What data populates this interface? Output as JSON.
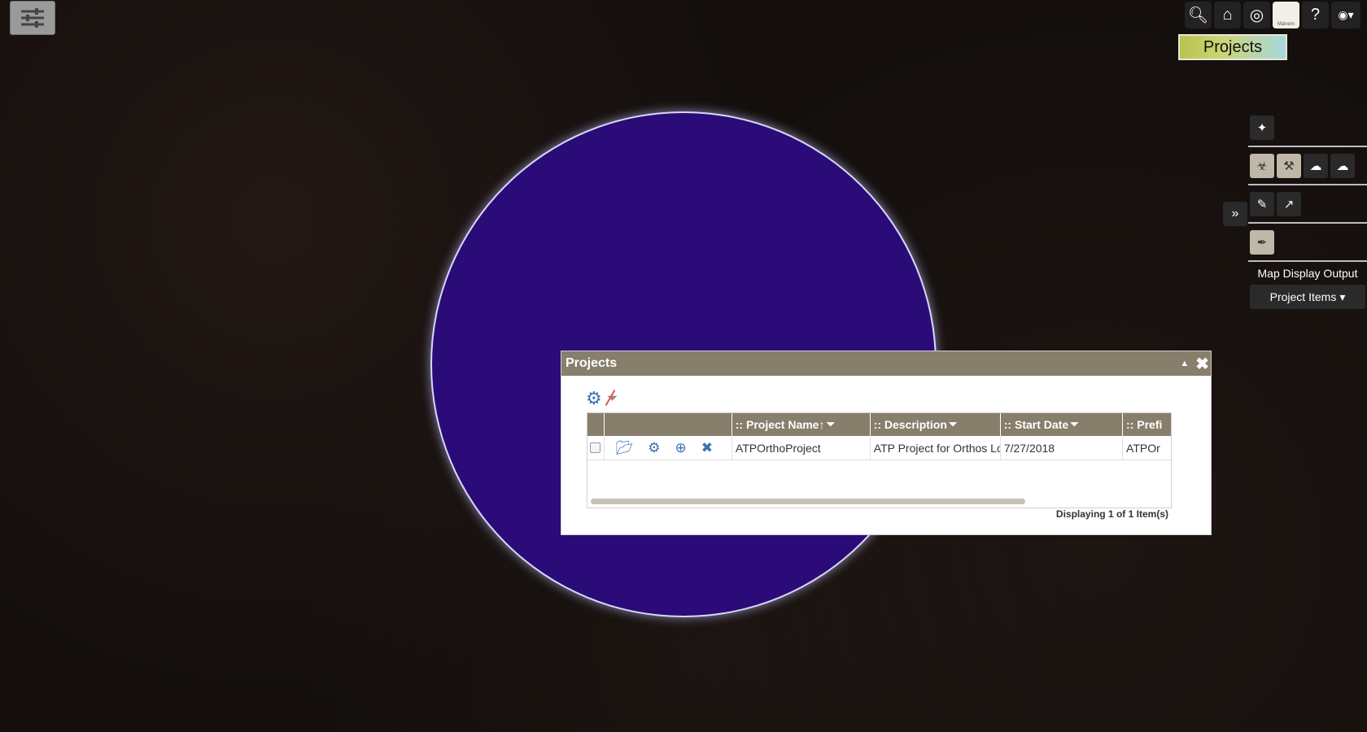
{
  "topbar": {
    "icons": [
      "search-icon",
      "home-icon",
      "globe-icon",
      "malvern-logo",
      "help-icon",
      "user-icon"
    ],
    "malvern_label": "Malvern"
  },
  "banner": {
    "label": "Projects"
  },
  "right_panel": {
    "map_display_label": "Map Display Output",
    "project_items_label": "Project Items"
  },
  "dialog": {
    "title": "Projects",
    "columns": [
      ":: Project Name↑",
      ":: Description",
      ":: Start Date",
      ":: Prefi"
    ],
    "rows": [
      {
        "name": "ATPOrthoProject",
        "description": "ATP Project for Orthos Lo",
        "start_date": "7/27/2018",
        "prefix": "ATPOr"
      }
    ],
    "footer": {
      "prefix": "Displaying ",
      "start": "1",
      "mid": " of ",
      "total": "1",
      "suffix": " Item(s)"
    }
  },
  "colors": {
    "header_bg": "#877e6b",
    "globe": "#2a0b78",
    "accent_blue": "#3c72b4"
  }
}
